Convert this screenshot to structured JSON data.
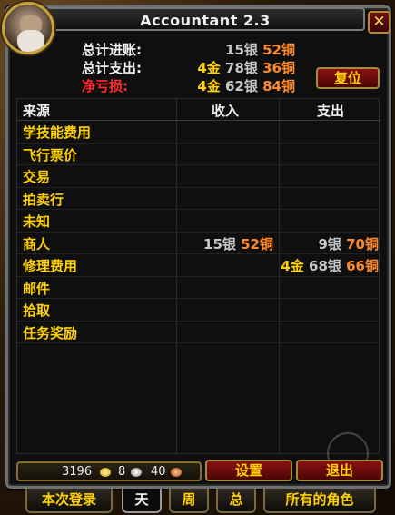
{
  "window": {
    "title": "Accountant 2.3",
    "close_label": "✕"
  },
  "summary": {
    "income_label": "总计进账:",
    "expense_label": "总计支出:",
    "net_label": "净亏损:",
    "income": {
      "silver": "15银",
      "copper": "52铜"
    },
    "expense": {
      "gold": "4金",
      "silver": "78银",
      "copper": "36铜"
    },
    "net": {
      "gold": "4金",
      "silver": "62银",
      "copper": "84铜"
    }
  },
  "reset_label": "复位",
  "table": {
    "headers": {
      "source": "来源",
      "income": "收入",
      "expense": "支出"
    },
    "rows": [
      {
        "source": "学技能费用"
      },
      {
        "source": "飞行票价"
      },
      {
        "source": "交易"
      },
      {
        "source": "拍卖行"
      },
      {
        "source": "未知"
      },
      {
        "source": "商人",
        "income": {
          "silver": "15银",
          "copper": "52铜"
        },
        "expense": {
          "silver": "9银",
          "copper": "70铜"
        }
      },
      {
        "source": "修理费用",
        "expense": {
          "gold": "4金",
          "silver": "68银",
          "copper": "66铜"
        }
      },
      {
        "source": "邮件"
      },
      {
        "source": "拾取"
      },
      {
        "source": "任务奖励"
      }
    ]
  },
  "money": {
    "gold": "3196",
    "silver": "8",
    "copper": "40"
  },
  "buttons": {
    "settings": "设置",
    "exit": "退出"
  },
  "tabs": [
    "本次登录",
    "天",
    "周",
    "总",
    "所有的角色"
  ],
  "active_tab": "天",
  "colors": {
    "gold": "#ffd100",
    "silver": "#c8c8c8",
    "copper": "#ff8a2a",
    "net_loss": "#ff2a2a"
  }
}
